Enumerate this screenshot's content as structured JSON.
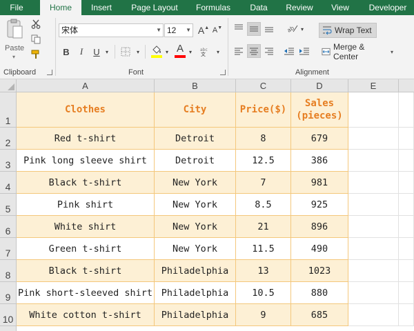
{
  "ribbon_tabs": [
    "File",
    "Home",
    "Insert",
    "Page Layout",
    "Formulas",
    "Data",
    "Review",
    "View",
    "Developer"
  ],
  "clipboard": {
    "paste_label": "Paste",
    "group_label": "Clipboard"
  },
  "font": {
    "name": "宋体",
    "size": "12",
    "group_label": "Font",
    "bold": "B",
    "italic": "I",
    "underline": "U",
    "grow": "A",
    "shrink": "A",
    "font_color_letter": "A",
    "font_color": "#ff0000",
    "fill_color": "#ffff00"
  },
  "alignment": {
    "wrap_text_label": "Wrap Text",
    "merge_label": "Merge & Center",
    "group_label": "Alignment"
  },
  "columns": [
    "A",
    "B",
    "C",
    "D",
    "E"
  ],
  "rows": [
    "1",
    "2",
    "3",
    "4",
    "5",
    "6",
    "7",
    "8",
    "9",
    "10"
  ],
  "table": {
    "headers": [
      "Clothes",
      "City",
      "Price($)",
      "Sales\n(pieces)"
    ],
    "rows": [
      [
        "Red t-shirt",
        "Detroit",
        "8",
        "679"
      ],
      [
        "Pink long sleeve shirt",
        "Detroit",
        "12.5",
        "386"
      ],
      [
        "Black t-shirt",
        "New York",
        "7",
        "981"
      ],
      [
        "Pink shirt",
        "New York",
        "8.5",
        "925"
      ],
      [
        "White shirt",
        "New York",
        "21",
        "896"
      ],
      [
        "Green t-shirt",
        "New York",
        "11.5",
        "490"
      ],
      [
        "Black t-shirt",
        "Philadelphia",
        "13",
        "1023"
      ],
      [
        "Pink short-sleeved shirt",
        "Philadelphia",
        "10.5",
        "880"
      ],
      [
        "White cotton t-shirt",
        "Philadelphia",
        "9",
        "685"
      ]
    ]
  },
  "colors": {
    "ribbon_accent": "#217346",
    "header_text": "#e67e22",
    "band_fill": "#fdf0d5",
    "table_border": "#f4c77b"
  }
}
